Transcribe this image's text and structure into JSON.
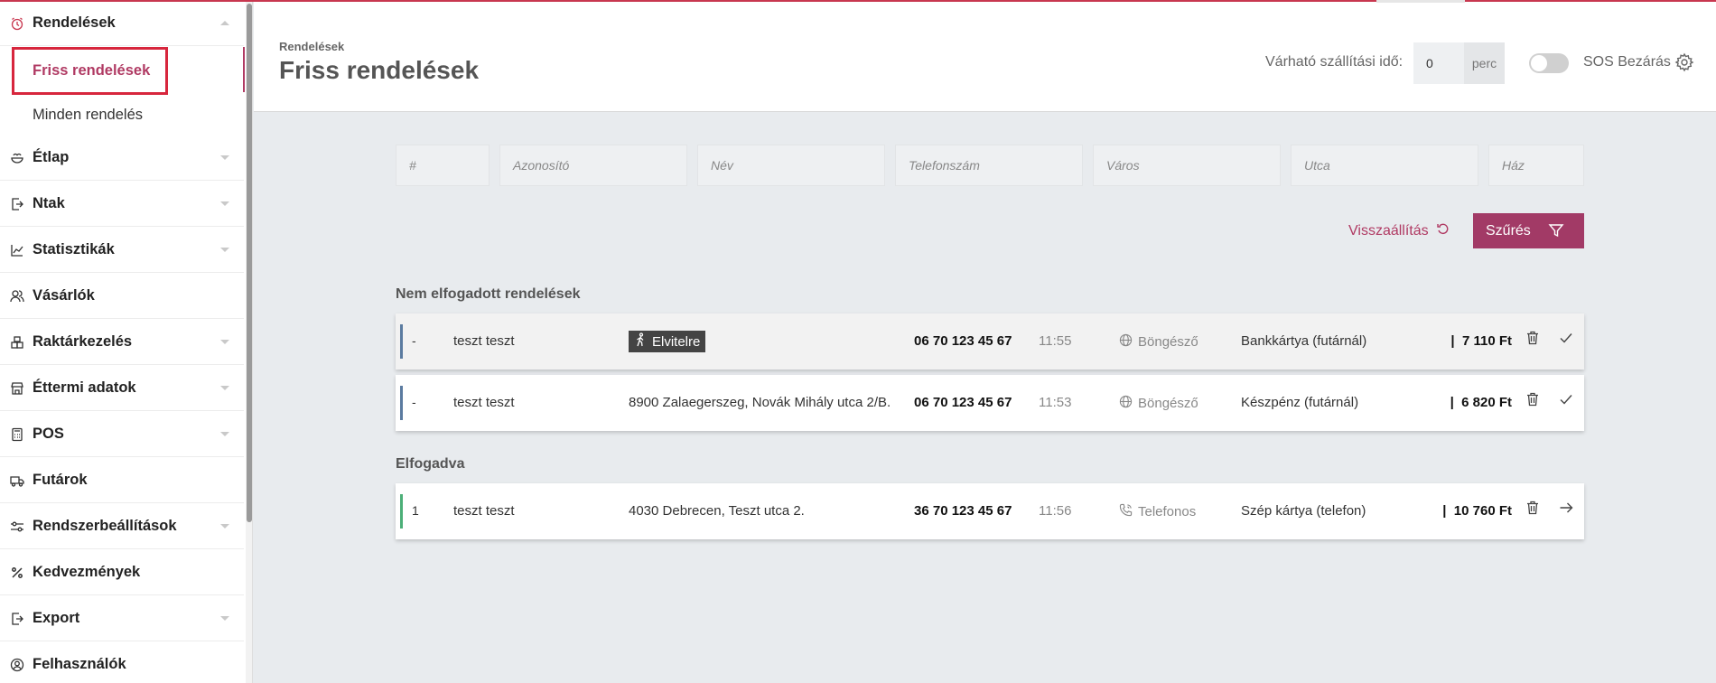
{
  "sidebar": {
    "items": [
      {
        "label": "Rendelések",
        "icon": "alarm-clock-icon",
        "expanded": true
      },
      {
        "label": "Étlap",
        "icon": "food-bowl-icon"
      },
      {
        "label": "Ntak",
        "icon": "export-file-icon"
      },
      {
        "label": "Statisztikák",
        "icon": "chart-icon"
      },
      {
        "label": "Vásárlók",
        "icon": "users-icon"
      },
      {
        "label": "Raktárkezelés",
        "icon": "boxes-icon"
      },
      {
        "label": "Éttermi adatok",
        "icon": "store-icon"
      },
      {
        "label": "POS",
        "icon": "calculator-icon"
      },
      {
        "label": "Futárok",
        "icon": "delivery-truck-icon"
      },
      {
        "label": "Rendszerbeállítások",
        "icon": "sliders-icon"
      },
      {
        "label": "Kedvezmények",
        "icon": "percent-icon"
      },
      {
        "label": "Export",
        "icon": "export-icon"
      },
      {
        "label": "Felhasználók",
        "icon": "user-circle-icon"
      }
    ],
    "subitems": [
      {
        "label": "Friss rendelések",
        "active": true
      },
      {
        "label": "Minden rendelés"
      }
    ]
  },
  "header": {
    "breadcrumb": "Rendelések",
    "title": "Friss rendelések",
    "delivery_label": "Várható szállítási idő:",
    "delivery_value": "0",
    "delivery_unit": "perc",
    "sos_label": "SOS Bezárás"
  },
  "filters": {
    "placeholders": [
      "#",
      "Azonosító",
      "Név",
      "Telefonszám",
      "Város",
      "Utca",
      "Ház"
    ],
    "reset_label": "Visszaállítás",
    "filter_label": "Szűrés"
  },
  "sections": {
    "pending_title": "Nem elfogadott rendelések",
    "accepted_title": "Elfogadva"
  },
  "orders": {
    "pending": [
      {
        "num": "-",
        "name": "teszt teszt",
        "takeaway_label": "Elvitelre",
        "phone": "06 70 123 45 67",
        "time": "11:55",
        "source": "Böngésző",
        "payment": "Bankkártya (futárnál)",
        "price": "7 110 Ft"
      },
      {
        "num": "-",
        "name": "teszt teszt",
        "address": "8900 Zalaegerszeg, Novák Mihály utca 2/B.",
        "phone": "06 70 123 45 67",
        "time": "11:53",
        "source": "Böngésző",
        "payment": "Készpénz (futárnál)",
        "price": "6 820 Ft"
      }
    ],
    "accepted": [
      {
        "num": "1",
        "name": "teszt teszt",
        "address": "4030 Debrecen, Teszt utca 2.",
        "phone": "36 70 123 45 67",
        "time": "11:56",
        "source": "Telefonos",
        "payment": "Szép kártya (telefon)",
        "price": "10 760 Ft"
      }
    ]
  },
  "colors": {
    "accent": "#b03a63",
    "button": "#a23a66",
    "highlight": "#d7263d"
  }
}
